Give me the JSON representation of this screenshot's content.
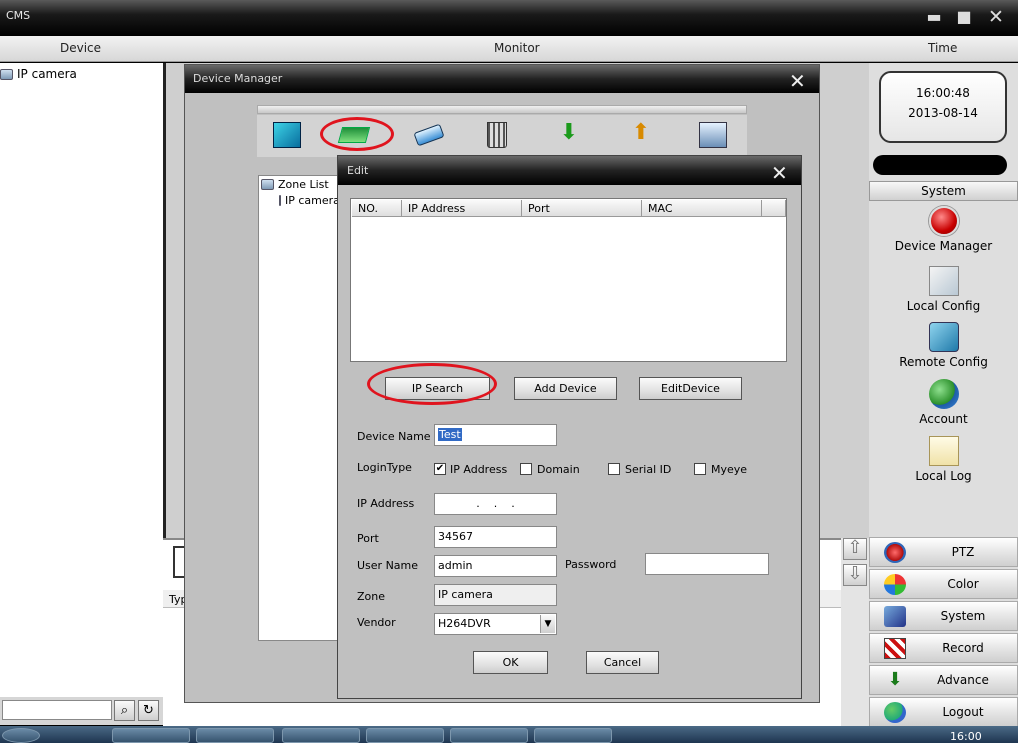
{
  "app": {
    "title": "CMS"
  },
  "header": {
    "device": "Device",
    "monitor": "Monitor",
    "time": "Time"
  },
  "device_tree": {
    "items": [
      {
        "label": "IP camera"
      }
    ]
  },
  "clock": {
    "time": "16:00:48",
    "date": "2013-08-14"
  },
  "right_panel": {
    "section_title": "System",
    "items": [
      {
        "label": "Device Manager",
        "icon": "device-manager-icon"
      },
      {
        "label": "Local Config",
        "icon": "local-config-icon"
      },
      {
        "label": "Remote Config",
        "icon": "remote-config-icon"
      },
      {
        "label": "Account",
        "icon": "account-icon"
      },
      {
        "label": "Local Log",
        "icon": "local-log-icon"
      }
    ],
    "buttons": [
      {
        "label": "PTZ",
        "icon": "ptz-icon"
      },
      {
        "label": "Color",
        "icon": "color-icon"
      },
      {
        "label": "System",
        "icon": "system-icon"
      },
      {
        "label": "Record",
        "icon": "record-icon"
      },
      {
        "label": "Advance",
        "icon": "advance-icon"
      },
      {
        "label": "Logout",
        "icon": "logout-icon"
      }
    ]
  },
  "lower_panel": {
    "column_header": "Typ"
  },
  "device_manager": {
    "title": "Device Manager",
    "zone_list": {
      "root": "Zone List",
      "child": "IP camera"
    }
  },
  "edit_dialog": {
    "title": "Edit",
    "table": {
      "columns": [
        "NO.",
        "IP Address",
        "Port",
        "MAC"
      ],
      "rows": []
    },
    "buttons": {
      "ip_search": "IP Search",
      "add_device": "Add Device",
      "edit_device": "EditDevice",
      "ok": "OK",
      "cancel": "Cancel"
    },
    "fields": {
      "device_name_label": "Device Name",
      "device_name_value": "Test",
      "login_type_label": "LoginType",
      "login_types": [
        {
          "label": "IP Address",
          "checked": true
        },
        {
          "label": "Domain",
          "checked": false
        },
        {
          "label": "Serial ID",
          "checked": false
        },
        {
          "label": "Myeye",
          "checked": false
        }
      ],
      "ip_address_label": "IP Address",
      "ip_address_value": ".    .    .",
      "port_label": "Port",
      "port_value": "34567",
      "user_name_label": "User Name",
      "user_name_value": "admin",
      "password_label": "Password",
      "password_value": "",
      "zone_label": "Zone",
      "zone_value": "IP camera",
      "vendor_label": "Vendor",
      "vendor_value": "H264DVR"
    }
  },
  "taskbar": {
    "clock": "16:00"
  },
  "colors": {
    "titlebar": "#000000",
    "highlight": "#e0141e",
    "selection": "#316ac5"
  }
}
